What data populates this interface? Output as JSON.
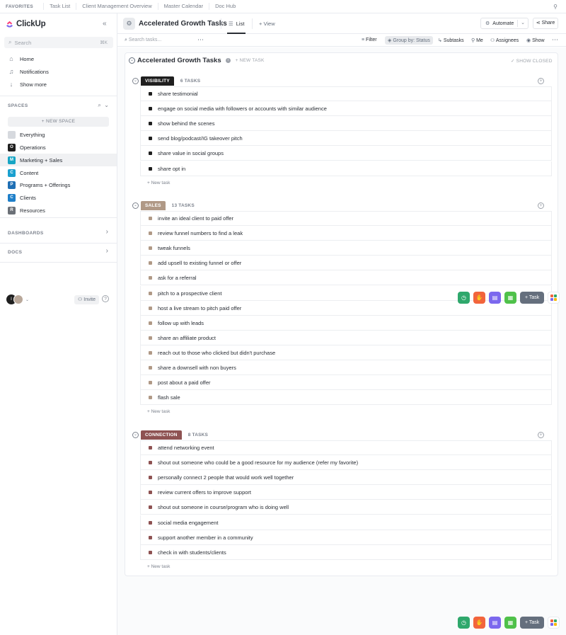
{
  "favorites": {
    "label": "FAVORITES",
    "items": [
      "Task List",
      "Client Management Overview",
      "Master Calendar",
      "Doc Hub"
    ]
  },
  "sidebar": {
    "brand": "ClickUp",
    "search_placeholder": "Search",
    "search_shortcut": "⌘K",
    "nav": [
      {
        "label": "Home",
        "icon": "home-icon"
      },
      {
        "label": "Notifications",
        "icon": "bell-icon"
      },
      {
        "label": "Show more",
        "icon": "arrow-down-icon"
      }
    ],
    "spaces_title": "SPACES",
    "new_space_label": "+ NEW SPACE",
    "spaces": [
      {
        "initial": "",
        "label": "Everything",
        "color": "#d6d9de"
      },
      {
        "initial": "O",
        "label": "Operations",
        "color": "#1f1f1f"
      },
      {
        "initial": "M",
        "label": "Marketing + Sales",
        "color": "#16a5c4"
      },
      {
        "initial": "C",
        "label": "Content",
        "color": "#1aa0cf"
      },
      {
        "initial": "P",
        "label": "Programs + Offerings",
        "color": "#1f6fb4"
      },
      {
        "initial": "C",
        "label": "Clients",
        "color": "#1e7fc9"
      },
      {
        "initial": "R",
        "label": "Resources",
        "color": "#6b7077"
      }
    ],
    "active_space": "Marketing + Sales",
    "dashboards_title": "DASHBOARDS",
    "docs_title": "DOCS",
    "user_initial": "I",
    "invite_label": "Invite",
    "help_label": "?"
  },
  "header": {
    "title": "Accelerated Growth Tasks",
    "tab_list": "List",
    "tab_view": "View",
    "automate_label": "Automate",
    "share_label": "Share"
  },
  "toolbar": {
    "search_placeholder": "Search tasks...",
    "filter": "Filter",
    "group_by": "Group by: Status",
    "subtasks": "Subtasks",
    "me": "Me",
    "assignees": "Assignees",
    "show": "Show"
  },
  "list": {
    "title": "Accelerated Growth Tasks",
    "new_task_label": "+ NEW TASK",
    "show_closed_label": "✓ SHOW CLOSED",
    "add_task_label": "+ New task"
  },
  "groups": [
    {
      "status": "VISIBILITY",
      "count_label": "6 TASKS",
      "color": "#1f1f1f",
      "tasks": [
        "share testimonial",
        "engage on social media with followers or accounts with similar audience",
        "show behind the scenes",
        "send blog/podcast/IG takeover pitch",
        "share value in social groups",
        "share opt in"
      ]
    },
    {
      "status": "SALES",
      "count_label": "13 TASKS",
      "color": "#b09986",
      "tasks": [
        "invite an ideal client to paid offer",
        "review funnel numbers to find a leak",
        "tweak funnels",
        "add upsell to existing funnel or offer",
        "ask for a referral",
        "pitch to a prospective client",
        "host a live stream to pitch paid offer",
        "follow up with leads",
        "share an affiliate product",
        "reach out to those who clicked but didn't purchase",
        "share a downsell with non buyers",
        "post about a paid offer",
        "flash sale"
      ]
    },
    {
      "status": "CONNECTION",
      "count_label": "8 TASKS",
      "color": "#8e5252",
      "tasks": [
        "attend networking event",
        "shout out someone who could be a good resource for my audience (refer my favorite)",
        "personally connect 2 people that would work well together",
        "review current offers to improve support",
        "shout out someone in course/program who is doing well",
        "social media engagement",
        "support another member in a community",
        "check in with students/clients"
      ]
    }
  ],
  "dock": {
    "task_label": "+ Task",
    "buttons": [
      {
        "icon": "timer-icon",
        "color": "#2fa86c"
      },
      {
        "icon": "hand-icon",
        "color": "#f2643c"
      },
      {
        "icon": "notepad-icon",
        "color": "#7b68ee"
      },
      {
        "icon": "calendar-icon",
        "color": "#4fc14a"
      }
    ]
  }
}
